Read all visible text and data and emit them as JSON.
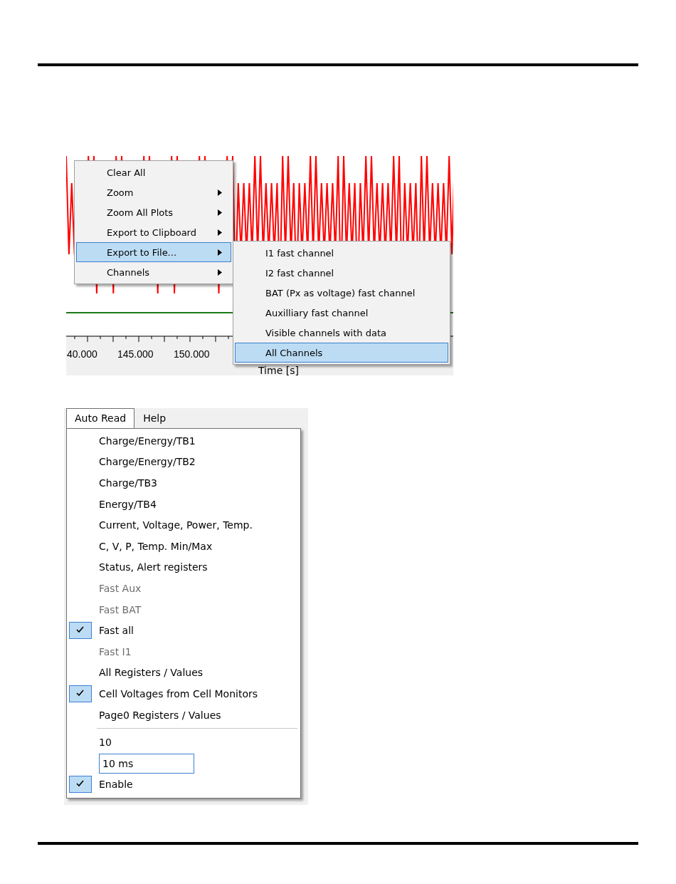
{
  "plot_screenshot": {
    "x_tick_labels": [
      "40.000",
      "145.000",
      "150.000"
    ],
    "axis_title": "Time [s]",
    "context_menu": [
      {
        "label": "Clear All",
        "has_submenu": false,
        "selected": false
      },
      {
        "label": "Zoom",
        "has_submenu": true,
        "selected": false
      },
      {
        "label": "Zoom All Plots",
        "has_submenu": true,
        "selected": false
      },
      {
        "label": "Export to Clipboard",
        "has_submenu": true,
        "selected": false
      },
      {
        "label": "Export to File...",
        "has_submenu": true,
        "selected": true
      },
      {
        "label": "Channels",
        "has_submenu": true,
        "selected": false
      }
    ],
    "submenu": [
      {
        "label": "I1 fast channel",
        "selected": false
      },
      {
        "label": "I2 fast channel",
        "selected": false
      },
      {
        "label": "BAT (Px as voltage) fast channel",
        "selected": false
      },
      {
        "label": "Auxilliary fast channel",
        "selected": false
      },
      {
        "label": "Visible channels with data",
        "selected": false
      },
      {
        "label": "All Channels",
        "selected": true
      }
    ]
  },
  "menu_screenshot": {
    "menubar": [
      {
        "label": "Auto Read",
        "selected": true
      },
      {
        "label": "Help",
        "selected": false
      }
    ],
    "menu": [
      {
        "kind": "item",
        "label": "Charge/Energy/TB1",
        "checked": false,
        "disabled": false
      },
      {
        "kind": "item",
        "label": "Charge/Energy/TB2",
        "checked": false,
        "disabled": false
      },
      {
        "kind": "item",
        "label": "Charge/TB3",
        "checked": false,
        "disabled": false
      },
      {
        "kind": "item",
        "label": "Energy/TB4",
        "checked": false,
        "disabled": false
      },
      {
        "kind": "item",
        "label": "Current, Voltage, Power, Temp.",
        "checked": false,
        "disabled": false
      },
      {
        "kind": "item",
        "label": "C, V, P, Temp. Min/Max",
        "checked": false,
        "disabled": false
      },
      {
        "kind": "item",
        "label": "Status, Alert registers",
        "checked": false,
        "disabled": false
      },
      {
        "kind": "item",
        "label": "Fast Aux",
        "checked": false,
        "disabled": true
      },
      {
        "kind": "item",
        "label": "Fast BAT",
        "checked": false,
        "disabled": true
      },
      {
        "kind": "item",
        "label": "Fast all",
        "checked": true,
        "disabled": false
      },
      {
        "kind": "item",
        "label": "Fast I1",
        "checked": false,
        "disabled": true
      },
      {
        "kind": "item",
        "label": "All Registers / Values",
        "checked": false,
        "disabled": false
      },
      {
        "kind": "item",
        "label": "Cell Voltages from Cell Monitors",
        "checked": true,
        "disabled": false
      },
      {
        "kind": "item",
        "label": "Page0 Registers / Values",
        "checked": false,
        "disabled": false
      },
      {
        "kind": "separator"
      },
      {
        "kind": "text",
        "label": "10"
      },
      {
        "kind": "field",
        "value": "10 ms"
      },
      {
        "kind": "item",
        "label": "Enable",
        "checked": true,
        "disabled": false
      }
    ]
  }
}
